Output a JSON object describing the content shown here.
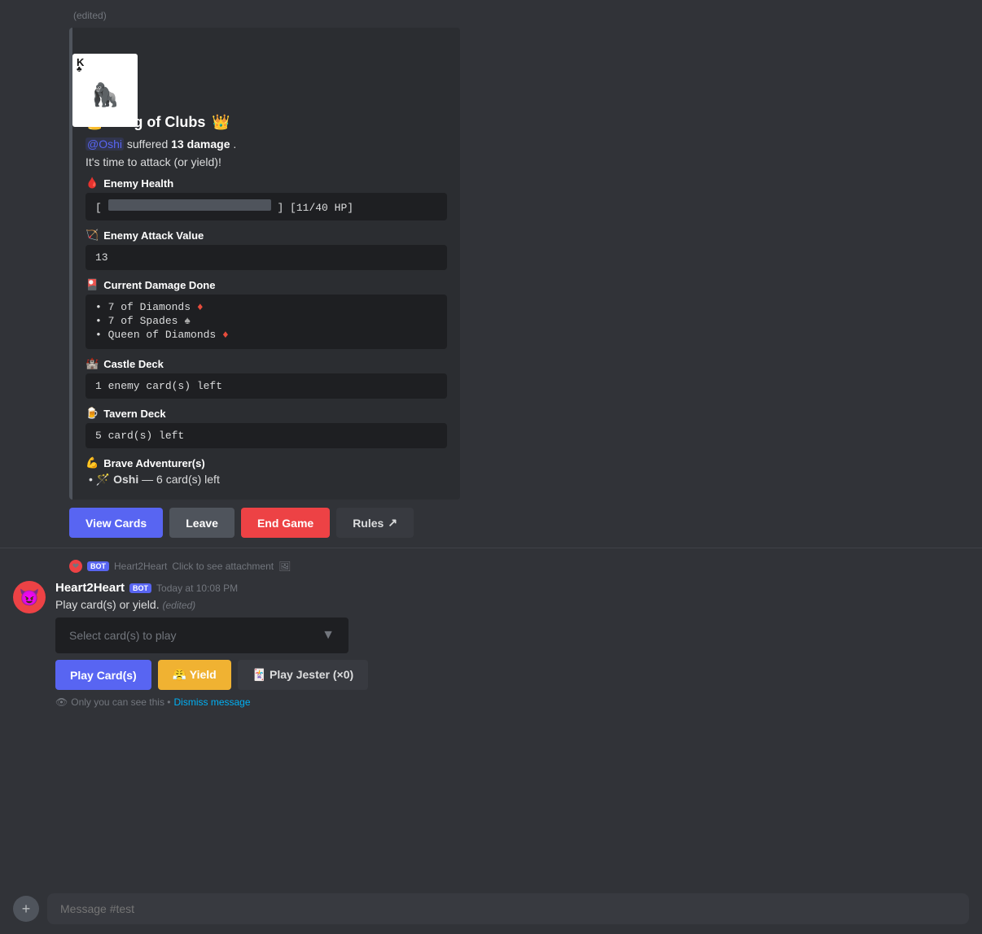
{
  "page": {
    "edited_label": "(edited)",
    "bot_name_header": "Heart2Heart",
    "click_attachment": "Click to see attachment"
  },
  "embed": {
    "title": "King of Clubs",
    "crown_emoji": "👑",
    "mention": "@Oshi",
    "damage_text": "suffered",
    "damage_amount": "13 damage",
    "attack_prompt": "It's time to attack (or yield)!",
    "sections": {
      "enemy_health": {
        "label": "Enemy Health",
        "icon": "🩸",
        "hp_current": 11,
        "hp_max": 40,
        "bar_display": "[ [11/40 HP]"
      },
      "enemy_attack": {
        "label": "Enemy Attack Value",
        "icon": "🏹",
        "value": "13"
      },
      "current_damage": {
        "label": "Current Damage Done",
        "icon": "🎴",
        "items": [
          {
            "text": "7 of Diamonds",
            "suit": "♦",
            "suit_class": "diamond"
          },
          {
            "text": "7 of Spades",
            "suit": "♠",
            "suit_class": "spade"
          },
          {
            "text": "Queen of Diamonds",
            "suit": "♦",
            "suit_class": "diamond"
          }
        ]
      },
      "castle_deck": {
        "label": "Castle Deck",
        "icon": "🏰",
        "value": "1 enemy card(s) left"
      },
      "tavern_deck": {
        "label": "Tavern Deck",
        "icon": "🍺",
        "value": "5 card(s) left"
      },
      "brave_adventurers": {
        "label": "Brave Adventurer(s)",
        "icon": "💪",
        "adventurers": [
          {
            "icon": "🪄",
            "name": "Oshi",
            "cards": "6 card(s) left"
          }
        ]
      }
    }
  },
  "action_buttons": {
    "view_cards": "View Cards",
    "leave": "Leave",
    "end_game": "End Game",
    "rules": "Rules",
    "rules_icon": "↗"
  },
  "second_message": {
    "bot_name": "Heart2Heart",
    "bot_badge": "BOT",
    "timestamp": "Today at 10:08 PM",
    "text": "Play card(s) or yield.",
    "edited": "(edited)",
    "select_placeholder": "Select card(s) to play",
    "play_button": "Play Card(s)",
    "yield_button": "😤 Yield",
    "jester_button": "🃏 Play Jester (×0)",
    "visibility_note": "Only you can see this •",
    "dismiss_link": "Dismiss message"
  },
  "message_input": {
    "placeholder": "Message #test"
  }
}
